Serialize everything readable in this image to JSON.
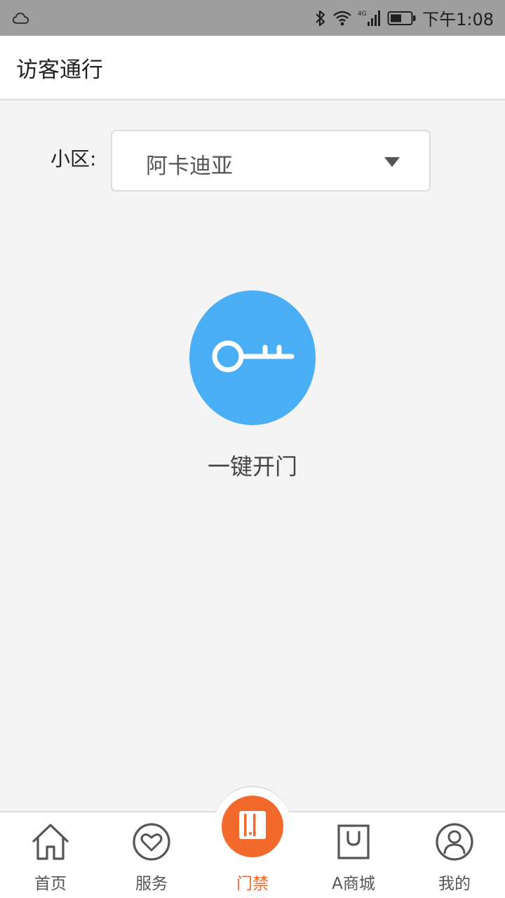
{
  "status_bar": {
    "time": "下午1:08",
    "network": "4G",
    "icons": [
      "cloud-icon",
      "bluetooth-icon",
      "wifi-icon",
      "cellular-signal-icon",
      "battery-icon"
    ]
  },
  "header": {
    "title": "访客通行"
  },
  "community": {
    "label": "小区:",
    "selected": "阿卡迪亚"
  },
  "unlock": {
    "icon": "key-icon",
    "label": "一键开门"
  },
  "bottom_nav": {
    "items": [
      {
        "label": "首页",
        "icon": "home-icon"
      },
      {
        "label": "服务",
        "icon": "heart-icon"
      },
      {
        "label": "门禁",
        "icon": "door-icon",
        "active": true
      },
      {
        "label": "A商城",
        "icon": "shopping-bag-icon"
      },
      {
        "label": "我的",
        "icon": "user-icon"
      }
    ]
  },
  "colors": {
    "accent": "#f26a2b",
    "key_button": "#4aaef5",
    "status_bar": "#9e9e9e"
  }
}
